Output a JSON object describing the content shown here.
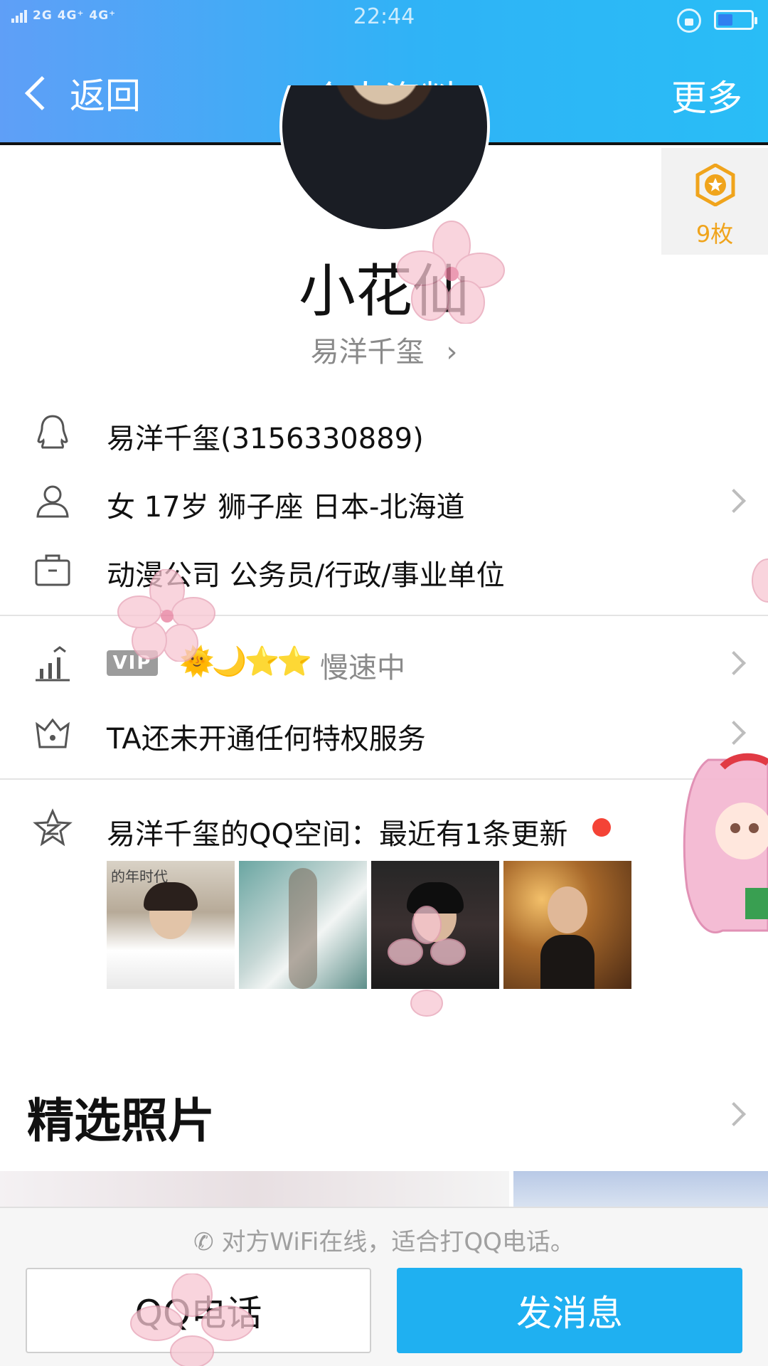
{
  "status_bar": {
    "network": "2G  4G⁺ 4G⁺",
    "time": "22:44"
  },
  "header": {
    "back_label": "返回",
    "title": "个人资料",
    "more_label": "更多"
  },
  "badge": {
    "count": "9枚"
  },
  "profile": {
    "nickname": "小花仙",
    "name_link": "易洋千玺",
    "name_link_arrow": "›"
  },
  "info_rows": [
    {
      "icon": "qq-penguin-icon",
      "text": "易洋千玺(3156330889)"
    },
    {
      "icon": "person-icon",
      "text": "女  17岁  狮子座  日本-北海道"
    },
    {
      "icon": "briefcase-icon",
      "text": "动漫公司 公务员/行政/事业单位"
    }
  ],
  "level_row": {
    "vip_label": "VIP",
    "level_icons": "🌞🌙⭐⭐",
    "status": "慢速中"
  },
  "privilege_row": {
    "text": "TA还未开通任何特权服务"
  },
  "qzone_row": {
    "text": "易洋千玺的QQ空间：最近有1条更新",
    "thumb_caption": "的年时代"
  },
  "featured": {
    "title": "精选照片"
  },
  "bottom": {
    "hint": "对方WiFi在线，适合打QQ电话。",
    "call_label": "QQ电话",
    "send_label": "发消息"
  },
  "colors": {
    "header_start": "#5f9ff7",
    "header_end": "#29bdf6",
    "send_button": "#1fb0f1",
    "badge_orange": "#f0a41c",
    "notify_red": "#f44336"
  }
}
